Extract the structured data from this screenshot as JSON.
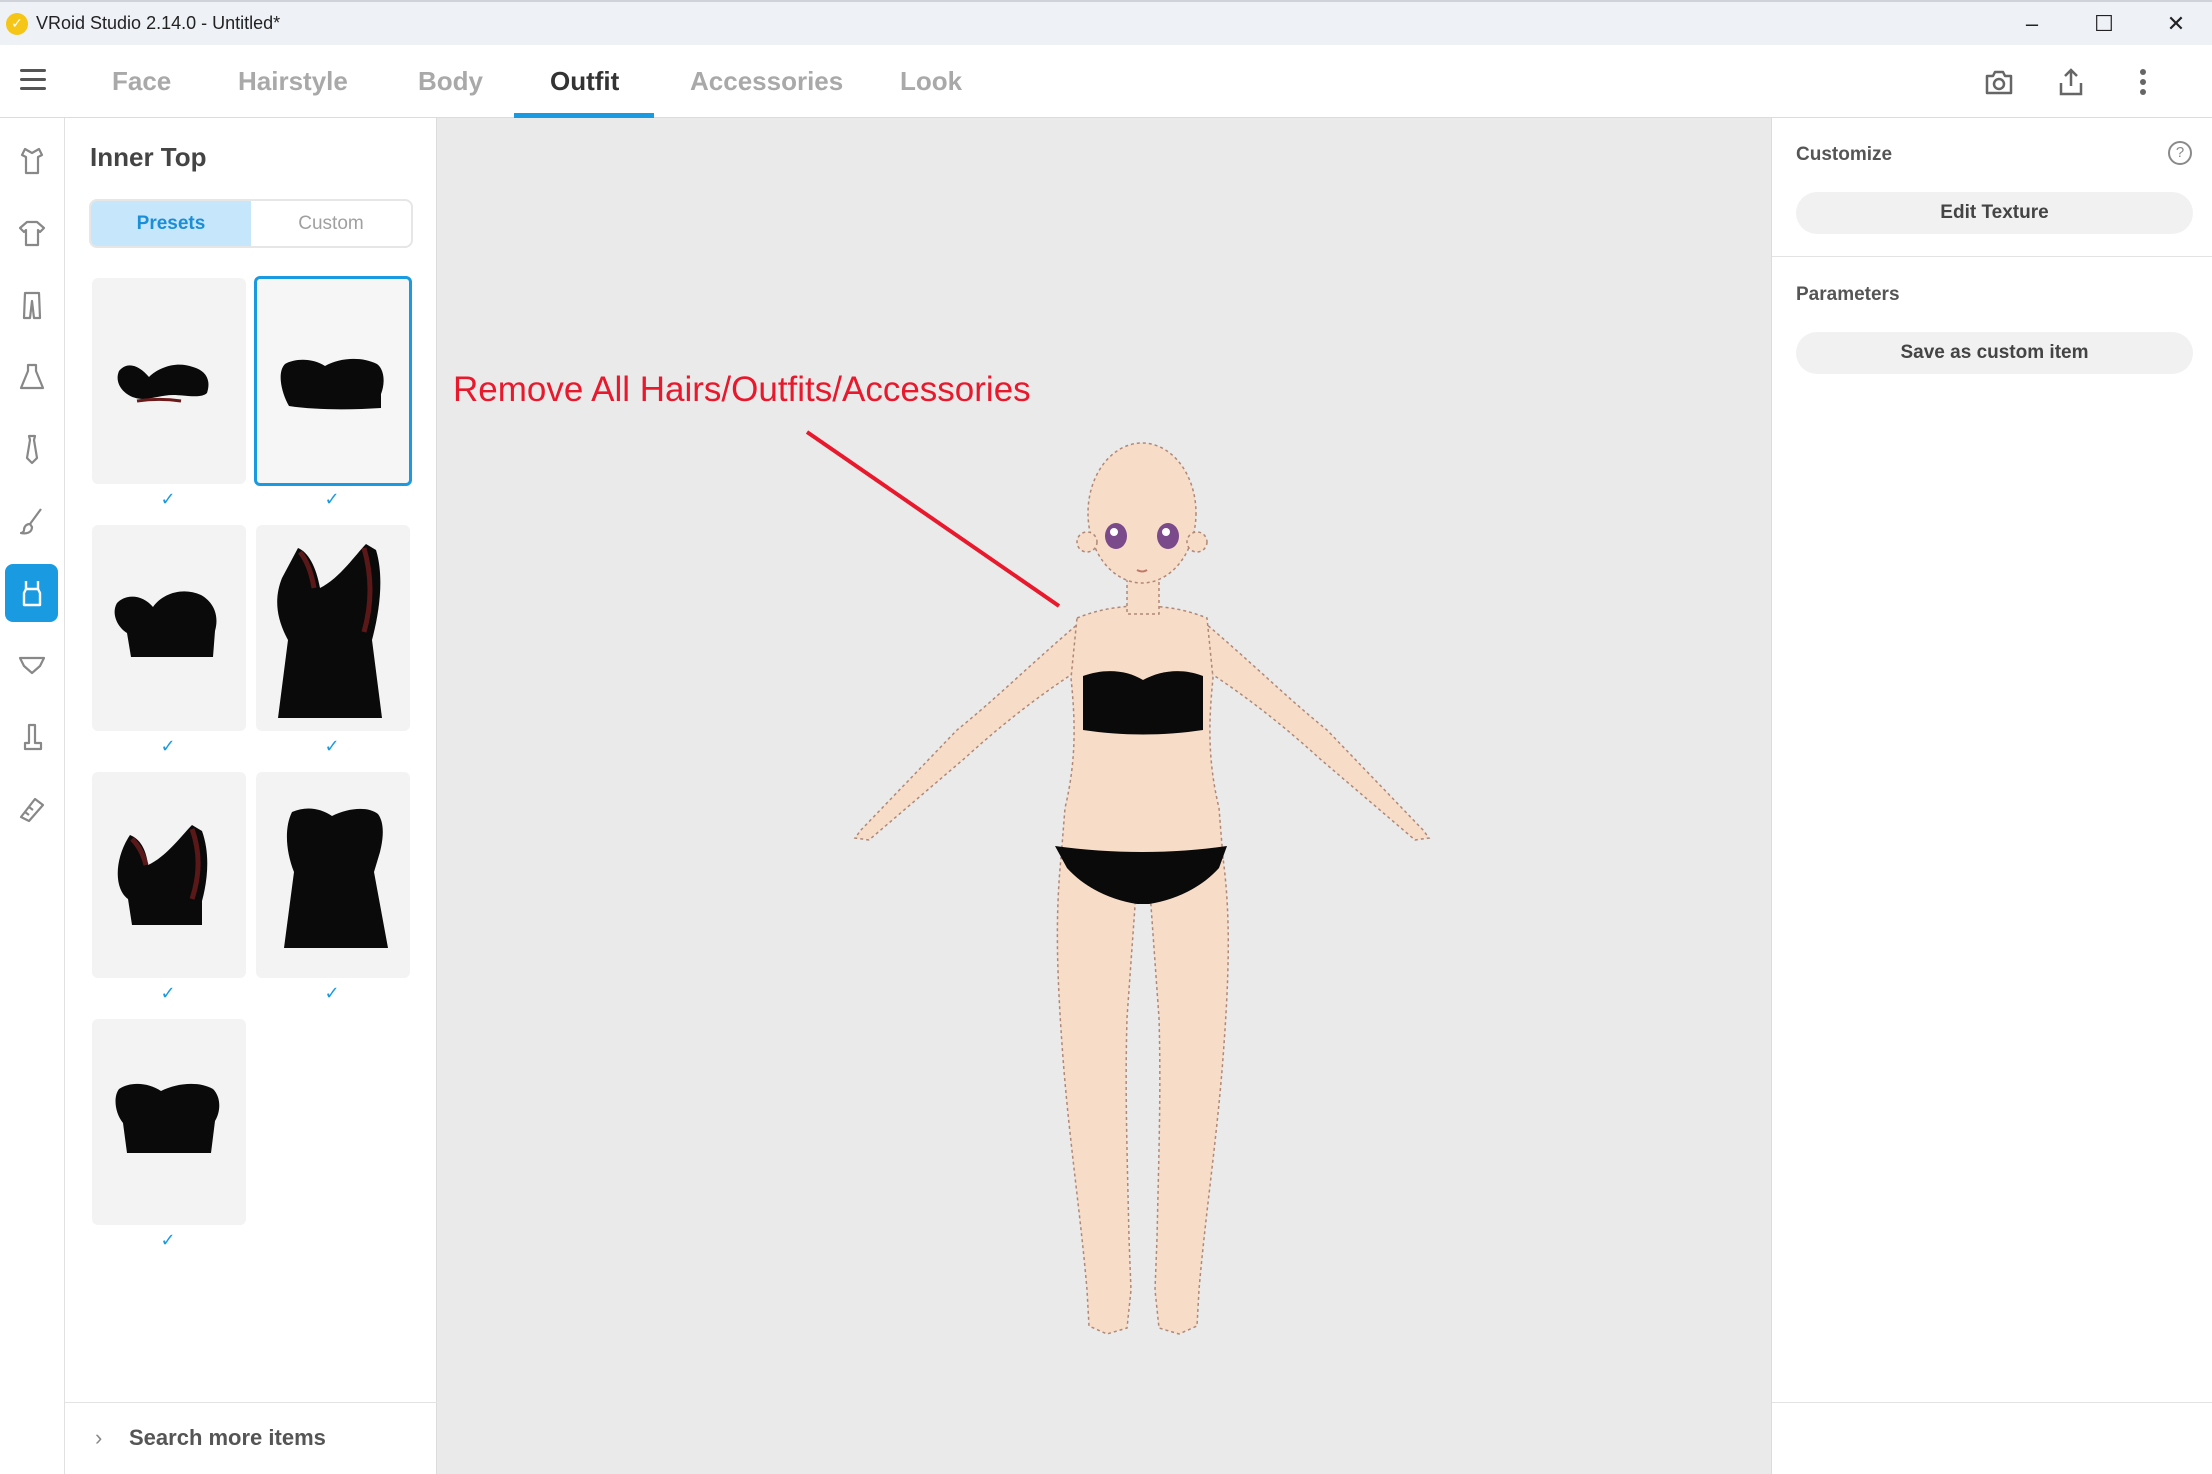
{
  "window": {
    "title": "VRoid Studio 2.14.0 - Untitled*",
    "controls": [
      "–",
      "☐",
      "✕"
    ]
  },
  "nav": {
    "tabs": [
      {
        "label": "Face",
        "active": false
      },
      {
        "label": "Hairstyle",
        "active": false
      },
      {
        "label": "Body",
        "active": false
      },
      {
        "label": "Outfit",
        "active": true
      },
      {
        "label": "Accessories",
        "active": false
      },
      {
        "label": "Look",
        "active": false
      }
    ],
    "tools": [
      "camera-icon",
      "export-icon",
      "more-vertical-icon"
    ]
  },
  "rail": {
    "items": [
      "outfit-set-icon",
      "tops-icon",
      "bottoms-icon",
      "onepiece-icon",
      "necktie-icon",
      "brush-icon",
      "inner-top-icon",
      "inner-bottom-icon",
      "socks-icon",
      "shoes-icon"
    ],
    "active_index": 6
  },
  "panel": {
    "title": "Inner Top",
    "segments": {
      "presets": "Presets",
      "custom": "Custom"
    },
    "active_segment": "presets",
    "items": [
      {
        "name": "twisted-bandeau",
        "checked": true,
        "selected": false
      },
      {
        "name": "tube-top",
        "checked": true,
        "selected": true
      },
      {
        "name": "bandeau-sweetheart",
        "checked": true,
        "selected": false
      },
      {
        "name": "one-shoulder-long",
        "checked": true,
        "selected": false
      },
      {
        "name": "one-shoulder-short",
        "checked": true,
        "selected": false
      },
      {
        "name": "strapless-long",
        "checked": true,
        "selected": false
      },
      {
        "name": "crop-tube",
        "checked": true,
        "selected": false
      }
    ],
    "check_glyph": "✓",
    "footer": {
      "chevron": "›",
      "label": "Search more items"
    }
  },
  "viewport": {
    "annotation": "Remove All Hairs/Outfits/Accessories",
    "annotation_color": "#e8192c"
  },
  "right_panel": {
    "customize": {
      "title": "Customize",
      "help": "?",
      "button": "Edit Texture"
    },
    "parameters": {
      "title": "Parameters",
      "button": "Save as custom item"
    }
  },
  "colors": {
    "accent": "#1a9ae0",
    "skin": "#f7dcc8",
    "garment": "#0a0a0a"
  }
}
